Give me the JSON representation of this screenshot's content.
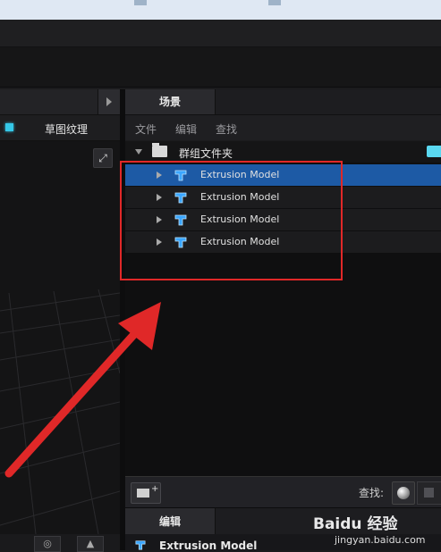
{
  "left_panel": {
    "tab_label": "草图纹理",
    "viewport_button_icon": "fullscreen-icon"
  },
  "scene_panel": {
    "tab": "场景",
    "menu": [
      "文件",
      "编辑",
      "查找"
    ],
    "group": {
      "label": "群组文件夹",
      "icon": "folder-icon"
    },
    "items": [
      {
        "label": "Extrusion Model",
        "selected": true,
        "icon": "extrusion-model-icon"
      },
      {
        "label": "Extrusion Model",
        "selected": false,
        "icon": "extrusion-model-icon"
      },
      {
        "label": "Extrusion Model",
        "selected": false,
        "icon": "extrusion-model-icon"
      },
      {
        "label": "Extrusion Model",
        "selected": false,
        "icon": "extrusion-model-icon"
      }
    ],
    "footer": {
      "find_label": "查找:"
    }
  },
  "edit_panel": {
    "tab": "编辑",
    "object_name": "Extrusion Model"
  },
  "watermark": {
    "line1": "Baidu 经验",
    "line2": "jingyan.baidu.com"
  },
  "colors": {
    "selection": "#1d5aa5",
    "annotation_red": "#e02828",
    "accent_cyan": "#35c8e8"
  }
}
